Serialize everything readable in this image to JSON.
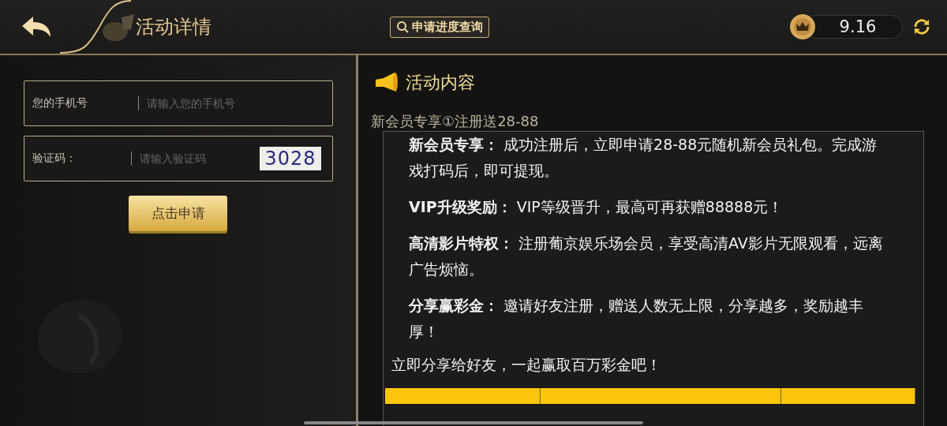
{
  "header": {
    "title": "活动详情",
    "query_button": "申请进度查询",
    "balance": "9.16"
  },
  "form": {
    "fields": [
      {
        "kind": "phone",
        "label": "您的手机号",
        "placeholder": "请输入您的手机号"
      },
      {
        "kind": "captcha",
        "label": "验证码：",
        "placeholder": "请输入验证码",
        "captcha": "3028"
      }
    ],
    "submit": "点击申请"
  },
  "content": {
    "heading": "活动内容",
    "subtitle": "新会员专享①注册送28-88",
    "paragraphs": [
      "**新会员专享：** 成功注册后，立即申请28-88元随机新会员礼包。完成游戏打码后，即可提现。",
      "**VIP升级奖励：** VIP等级晋升，最高可再获赠88888元！",
      "**高清影片特权：** 注册葡京娱乐场会员，享受高清AV影片无限观看，远离广告烦恼。",
      "**分享赢彩金：** 邀请好友注册，赠送人数无上限，分享越多，奖励越丰厚！"
    ],
    "closing": "立即分享给好友，一起赢取百万彩金吧！"
  }
}
